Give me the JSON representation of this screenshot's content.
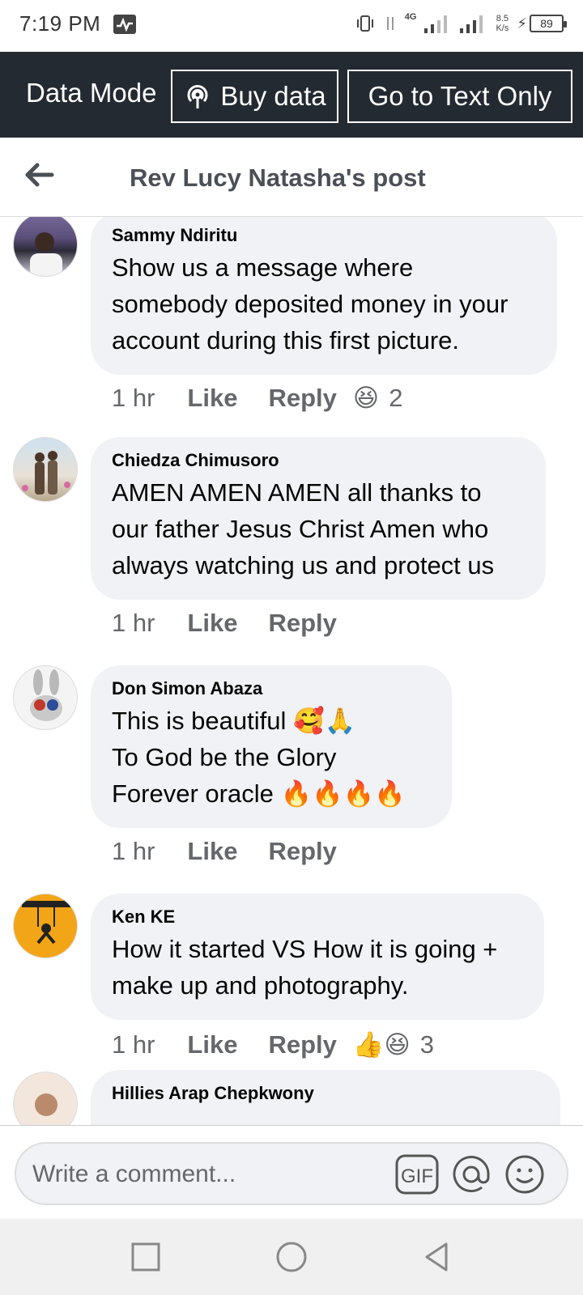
{
  "status_bar": {
    "time": "7:19 PM",
    "network": "4G",
    "speed_value": "8.5",
    "speed_unit": "K/s",
    "battery": "89"
  },
  "data_banner": {
    "mode_label": "Data Mode",
    "buy_data_label": "Buy data",
    "text_only_label": "Go to Text Only"
  },
  "header": {
    "title": "Rev Lucy Natasha's post"
  },
  "comments": [
    {
      "author": "Sammy Ndiritu",
      "text": "Show us a message where\nsomebody deposited money in your\naccount during this first picture.",
      "time": "1 hr",
      "like_label": "Like",
      "reply_label": "Reply",
      "reactions": "😆",
      "reaction_count": "2"
    },
    {
      "author": "Chiedza Chimusoro",
      "text": "AMEN AMEN AMEN all thanks to\nour father Jesus Christ Amen who\nalways watching us and protect us",
      "time": "1 hr",
      "like_label": "Like",
      "reply_label": "Reply"
    },
    {
      "author": "Don Simon Abaza",
      "text": "This is beautiful 🥰🙏\nTo God be the Glory\nForever oracle 🔥🔥🔥🔥",
      "time": "1 hr",
      "like_label": "Like",
      "reply_label": "Reply"
    },
    {
      "author": "Ken KE",
      "text": "How it started VS How it is going +\nmake up and photography.",
      "time": "1 hr",
      "like_label": "Like",
      "reply_label": "Reply",
      "reactions": "👍😆",
      "reaction_count": "3"
    },
    {
      "author": "Hillies Arap Chepkwony"
    }
  ],
  "composer": {
    "placeholder": "Write a comment...",
    "gif_label": "GIF"
  },
  "colors": {
    "banner_bg": "#242a32",
    "bubble_bg": "#f0f2f5",
    "meta_text": "#65676b",
    "like_blue": "#1877f2",
    "haha_yellow": "#f7b928"
  }
}
